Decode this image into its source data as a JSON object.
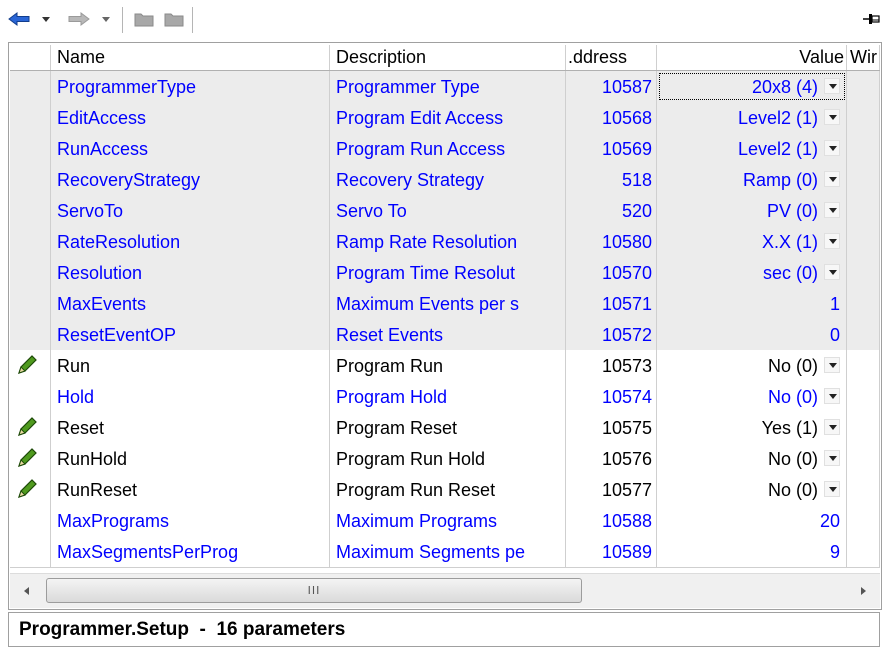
{
  "toolbar": {
    "back_icon": "back-arrow-icon",
    "forward_icon": "forward-arrow-icon",
    "folder_icon": "folder-icon",
    "pin_icon": "pin-icon"
  },
  "columns": {
    "name": "Name",
    "description": "Description",
    "address": ".ddress",
    "value": "Value",
    "wired": "Wir"
  },
  "rows": [
    {
      "name": "ProgrammerType",
      "description": "Programmer Type",
      "address": "10587",
      "value": "20x8 (4)",
      "dropdown": true,
      "editable": false,
      "focused": true
    },
    {
      "name": "EditAccess",
      "description": "Program Edit Access",
      "address": "10568",
      "value": "Level2 (1)",
      "dropdown": true,
      "editable": false
    },
    {
      "name": "RunAccess",
      "description": "Program Run Access",
      "address": "10569",
      "value": "Level2 (1)",
      "dropdown": true,
      "editable": false
    },
    {
      "name": "RecoveryStrategy",
      "description": "Recovery Strategy",
      "address": "518",
      "value": "Ramp (0)",
      "dropdown": true,
      "editable": false
    },
    {
      "name": "ServoTo",
      "description": "Servo To",
      "address": "520",
      "value": "PV (0)",
      "dropdown": true,
      "editable": false
    },
    {
      "name": "RateResolution",
      "description": "Ramp Rate Resolution",
      "address": "10580",
      "value": "X.X (1)",
      "dropdown": true,
      "editable": false
    },
    {
      "name": "Resolution",
      "description": "Program Time Resolut",
      "address": "10570",
      "value": "sec (0)",
      "dropdown": true,
      "editable": false
    },
    {
      "name": "MaxEvents",
      "description": "Maximum Events per s",
      "address": "10571",
      "value": "1",
      "dropdown": false,
      "editable": false
    },
    {
      "name": "ResetEventOP",
      "description": "Reset Events",
      "address": "10572",
      "value": "0",
      "dropdown": false,
      "editable": false
    },
    {
      "name": "Run",
      "description": "Program Run",
      "address": "10573",
      "value": "No (0)",
      "dropdown": true,
      "editable": true
    },
    {
      "name": "Hold",
      "description": "Program Hold",
      "address": "10574",
      "value": "No (0)",
      "dropdown": true,
      "editable": false,
      "white": true
    },
    {
      "name": "Reset",
      "description": "Program Reset",
      "address": "10575",
      "value": "Yes (1)",
      "dropdown": true,
      "editable": true
    },
    {
      "name": "RunHold",
      "description": "Program Run Hold",
      "address": "10576",
      "value": "No (0)",
      "dropdown": true,
      "editable": true
    },
    {
      "name": "RunReset",
      "description": "Program Run Reset",
      "address": "10577",
      "value": "No (0)",
      "dropdown": true,
      "editable": true
    },
    {
      "name": "MaxPrograms",
      "description": "Maximum Programs",
      "address": "10588",
      "value": "20",
      "dropdown": false,
      "editable": false,
      "white": true
    },
    {
      "name": "MaxSegmentsPerProg",
      "description": "Maximum Segments pe",
      "address": "10589",
      "value": "9",
      "dropdown": false,
      "editable": false,
      "white": true
    }
  ],
  "scrollbar": {
    "grip": "III",
    "left_icon": "scroll-left-icon",
    "right_icon": "scroll-right-icon"
  },
  "status": {
    "text": "Programmer.Setup  -  16 parameters"
  },
  "colors": {
    "link": "#0000ff",
    "readonly_bg": "#ececec",
    "pencil": "#3a7d1a"
  }
}
